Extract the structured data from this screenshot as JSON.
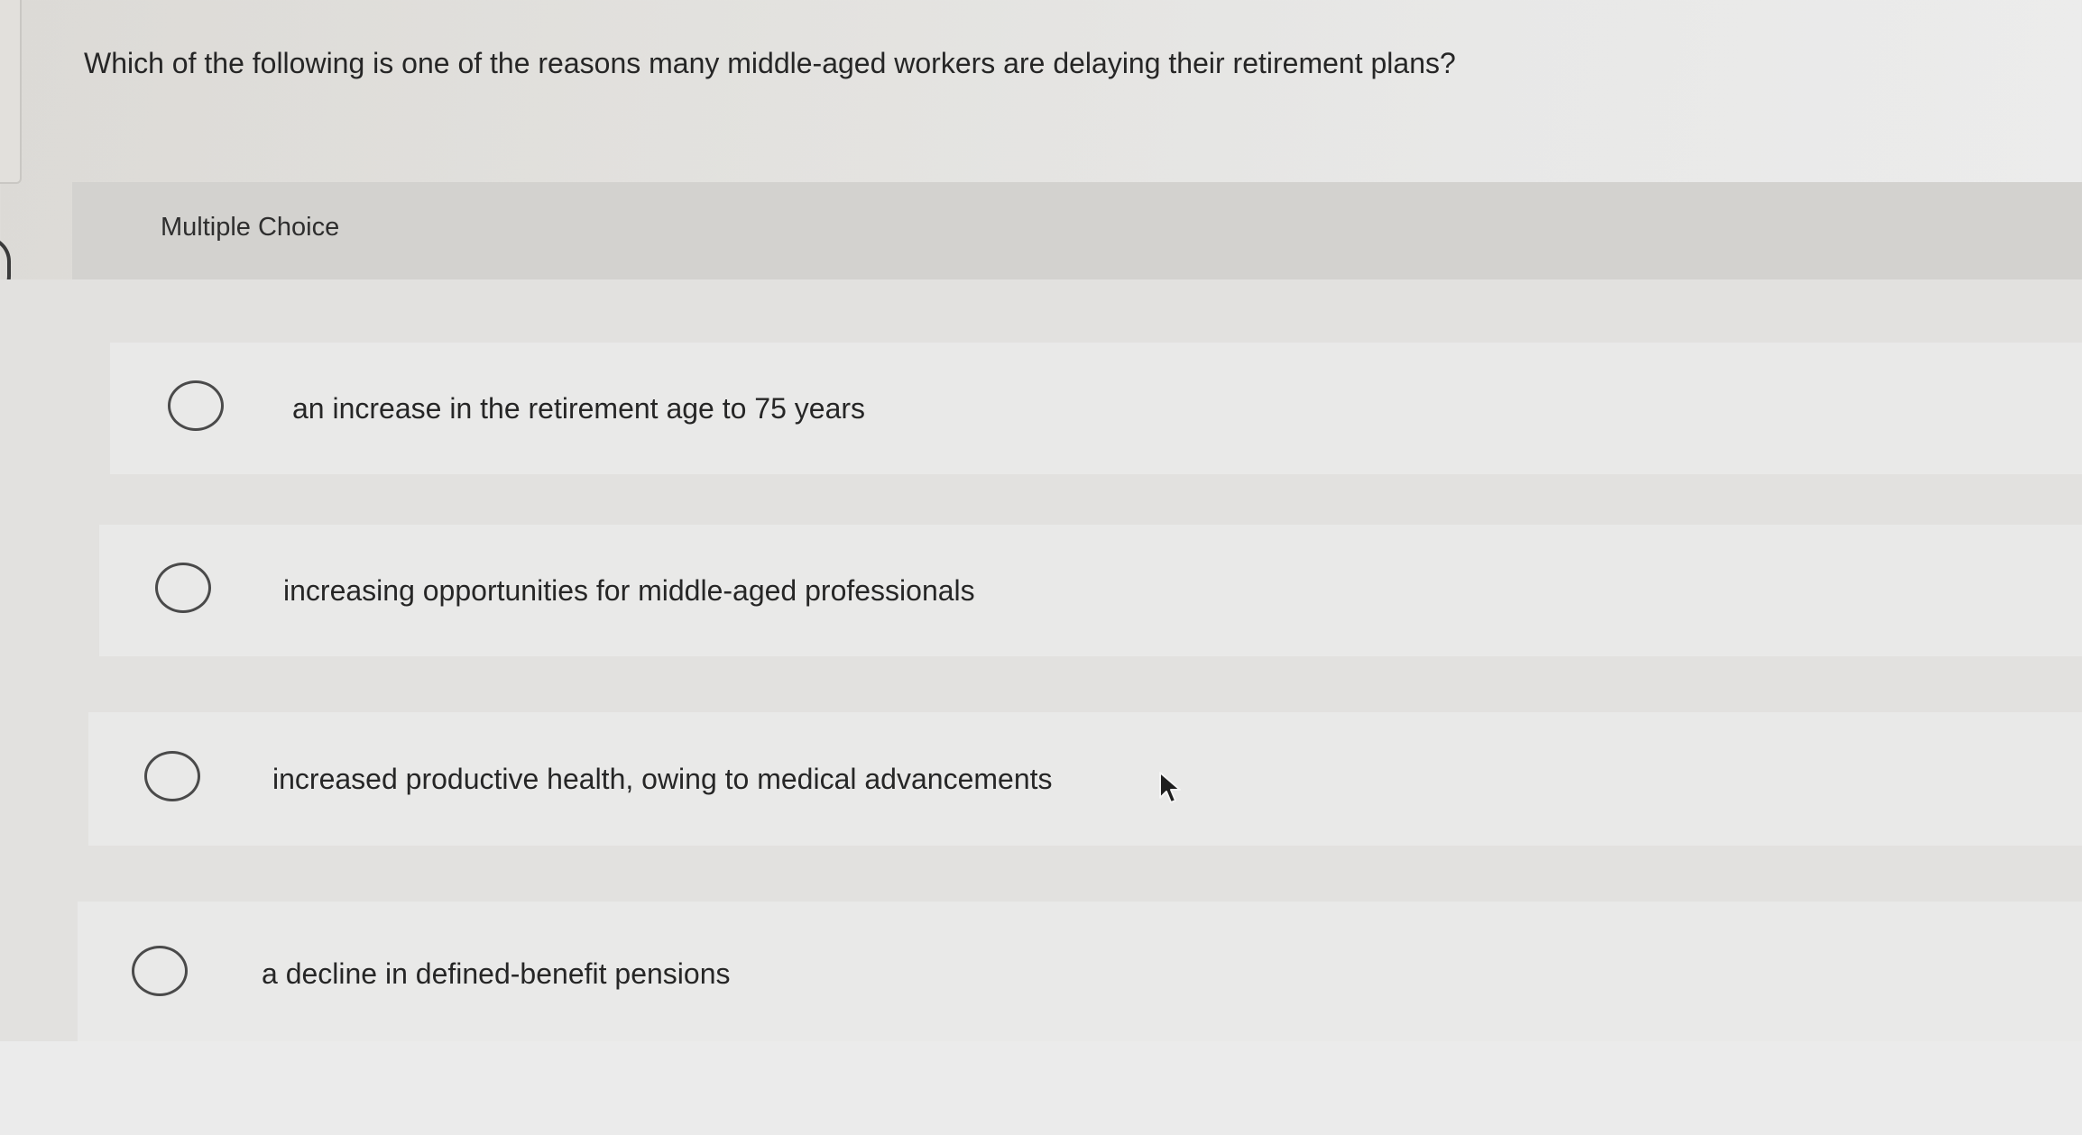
{
  "question": {
    "text": "Which of the following is one of the reasons many middle-aged workers are delaying their retirement plans?"
  },
  "answer_area": {
    "type_label": "Multiple Choice",
    "options": [
      {
        "label": "an increase in the retirement age to 75 years",
        "selected": false
      },
      {
        "label": "increasing opportunities for middle-aged professionals",
        "selected": false
      },
      {
        "label": "increased productive health, owing to medical advancements",
        "selected": false
      },
      {
        "label": "a decline in defined-benefit pensions",
        "selected": false
      }
    ]
  },
  "icons": {
    "radio": "radio-unselected-icon",
    "cursor": "mouse-pointer-icon"
  },
  "colors": {
    "background": "#e3e2df",
    "header_band": "#d3d2cf",
    "option_band": "#e9e9e8",
    "text": "#262626",
    "radio_border": "#4a4a4a"
  }
}
